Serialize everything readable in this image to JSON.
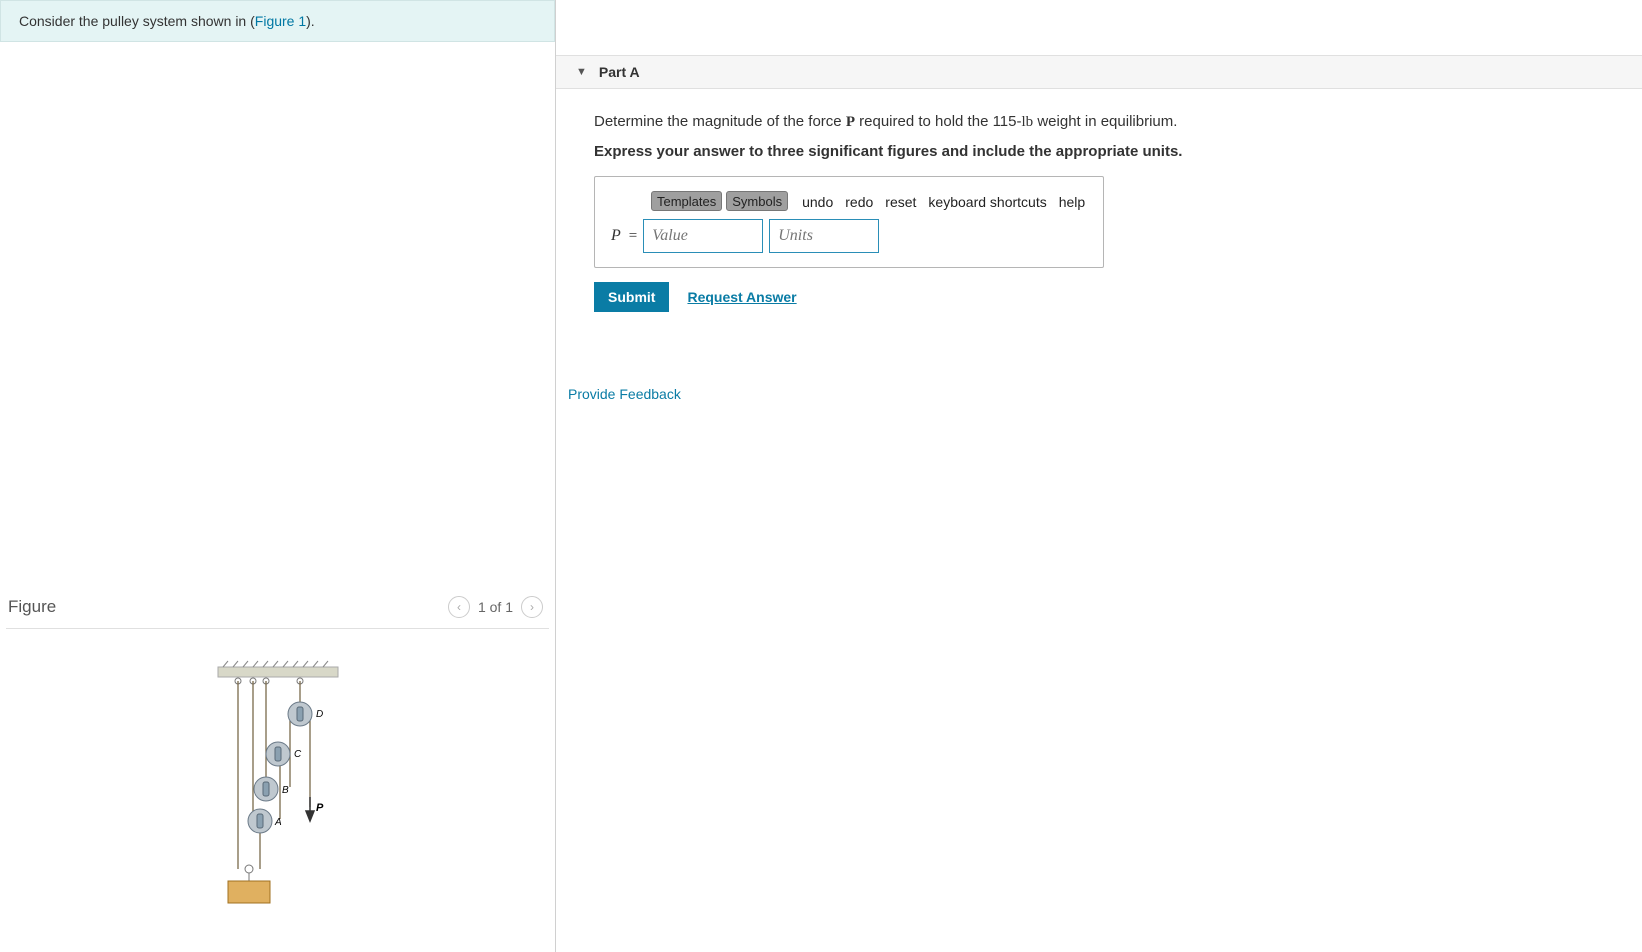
{
  "intro": {
    "prefix": "Consider the pulley system shown in (",
    "link": "Figure 1",
    "suffix": ")."
  },
  "figure": {
    "title": "Figure",
    "pager": "1 of 1",
    "labels": {
      "D": "D",
      "C": "C",
      "B": "B",
      "A": "A",
      "P": "P"
    }
  },
  "part": {
    "title": "Part A",
    "question_pre": "Determine the magnitude of the force ",
    "question_var": "P",
    "question_mid": " required to hold the 115-",
    "question_units": "lb",
    "question_post": " weight in equilibrium.",
    "instruction": "Express your answer to three significant figures and include the appropriate units."
  },
  "toolbar": {
    "templates": "Templates",
    "symbols": "Symbols",
    "undo": "undo",
    "redo": "redo",
    "reset": "reset",
    "keyboard": "keyboard shortcuts",
    "help": "help"
  },
  "answer": {
    "var": "P",
    "eq": "=",
    "value_placeholder": "Value",
    "units_placeholder": "Units"
  },
  "actions": {
    "submit": "Submit",
    "request": "Request Answer"
  },
  "feedback": "Provide Feedback"
}
